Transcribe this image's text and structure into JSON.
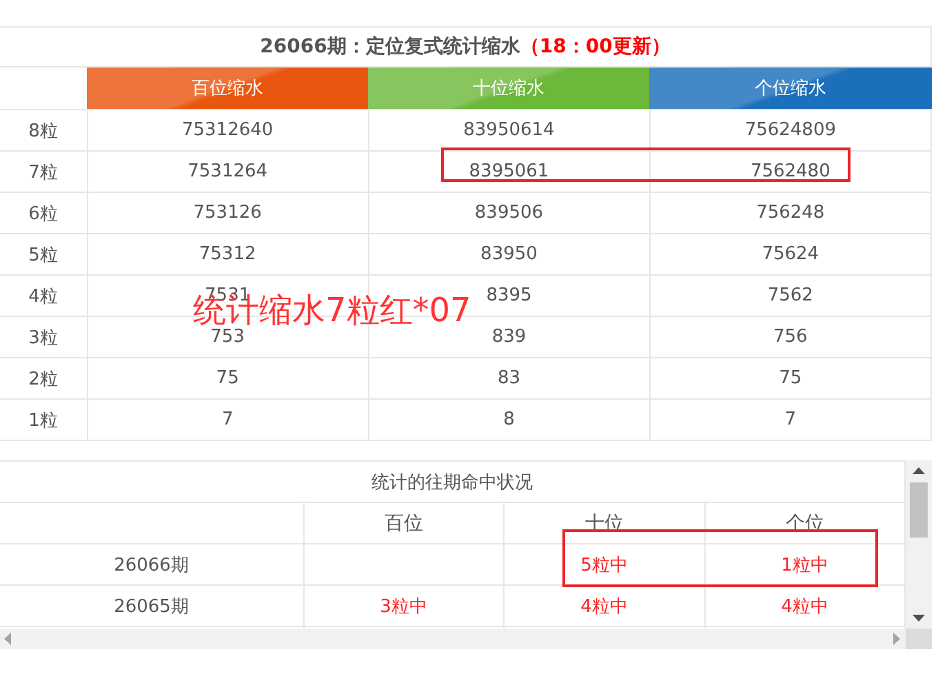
{
  "stats_table": {
    "title": "26066期：定位复式统计缩水",
    "title_note": "（18：00更新）",
    "columns": [
      {
        "label": "百位缩水",
        "color": "#e9560f"
      },
      {
        "label": "十位缩水",
        "color": "#6cb83a"
      },
      {
        "label": "个位缩水",
        "color": "#1b6fbb"
      }
    ],
    "rows": [
      {
        "label": "8粒",
        "cells": [
          "75312640",
          "83950614",
          "75624809"
        ]
      },
      {
        "label": "7粒",
        "cells": [
          "7531264",
          "8395061",
          "7562480"
        ]
      },
      {
        "label": "6粒",
        "cells": [
          "753126",
          "839506",
          "756248"
        ]
      },
      {
        "label": "5粒",
        "cells": [
          "75312",
          "83950",
          "75624"
        ]
      },
      {
        "label": "4粒",
        "cells": [
          "7531",
          "8395",
          "7562"
        ]
      },
      {
        "label": "3粒",
        "cells": [
          "753",
          "839",
          "756"
        ]
      },
      {
        "label": "2粒",
        "cells": [
          "75",
          "83",
          "75"
        ]
      },
      {
        "label": "1粒",
        "cells": [
          "7",
          "8",
          "7"
        ]
      }
    ]
  },
  "annotation": "统计缩水7粒红*07",
  "history_table": {
    "title": "统计的往期命中状况",
    "columns": [
      "百位",
      "十位",
      "个位"
    ],
    "rows": [
      {
        "issue": "26066期",
        "cells": [
          "",
          "5粒中",
          "1粒中"
        ]
      },
      {
        "issue": "26065期",
        "cells": [
          "3粒中",
          "4粒中",
          "4粒中"
        ]
      }
    ]
  }
}
